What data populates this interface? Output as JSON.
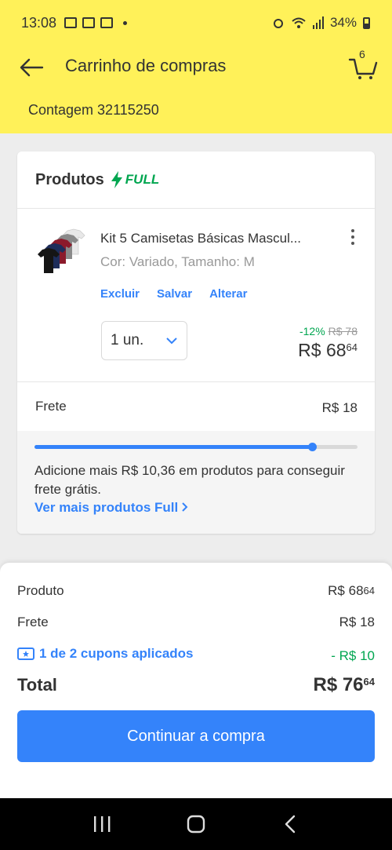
{
  "status_bar": {
    "time": "13:08",
    "battery": "34%"
  },
  "header": {
    "title": "Carrinho de compras",
    "cart_count": "6",
    "location": "Contagem 32115250"
  },
  "products_card": {
    "heading": "Produtos",
    "badge": "FULL",
    "item": {
      "name": "Kit 5 Camisetas Básicas Mascul...",
      "variant": "Cor: Variado, Tamanho: M",
      "actions": [
        "Excluir",
        "Salvar",
        "Alterar"
      ],
      "quantity": "1 un.",
      "discount": "-12%",
      "old_price": "R$ 78",
      "price_main": "R$ 68",
      "price_cents": "64"
    },
    "shipping": {
      "label": "Frete",
      "value": "R$ 18",
      "progress": 0.86,
      "message": "Adicione mais R$ 10,36 em produtos para conseguir frete grátis.",
      "link": "Ver mais produtos Full"
    }
  },
  "summary": {
    "product_label": "Produto",
    "product_main": "R$ 68",
    "product_cents": "64",
    "shipping_label": "Frete",
    "shipping_value": "R$ 18",
    "coupon_label": "1 de 2 cupons aplicados",
    "coupon_value": "- R$ 10",
    "total_label": "Total",
    "total_main": "R$ 76",
    "total_cents": "64",
    "cta": "Continuar a compra"
  },
  "colors": {
    "brand_yellow": "#fff159",
    "accent_blue": "#3483fa",
    "success_green": "#00a650"
  },
  "icons": [
    "back-arrow-icon",
    "cart-icon",
    "lightning-icon",
    "more-vertical-icon",
    "chevron-down-icon",
    "coupon-icon",
    "recents-icon",
    "home-icon",
    "back-nav-icon"
  ]
}
